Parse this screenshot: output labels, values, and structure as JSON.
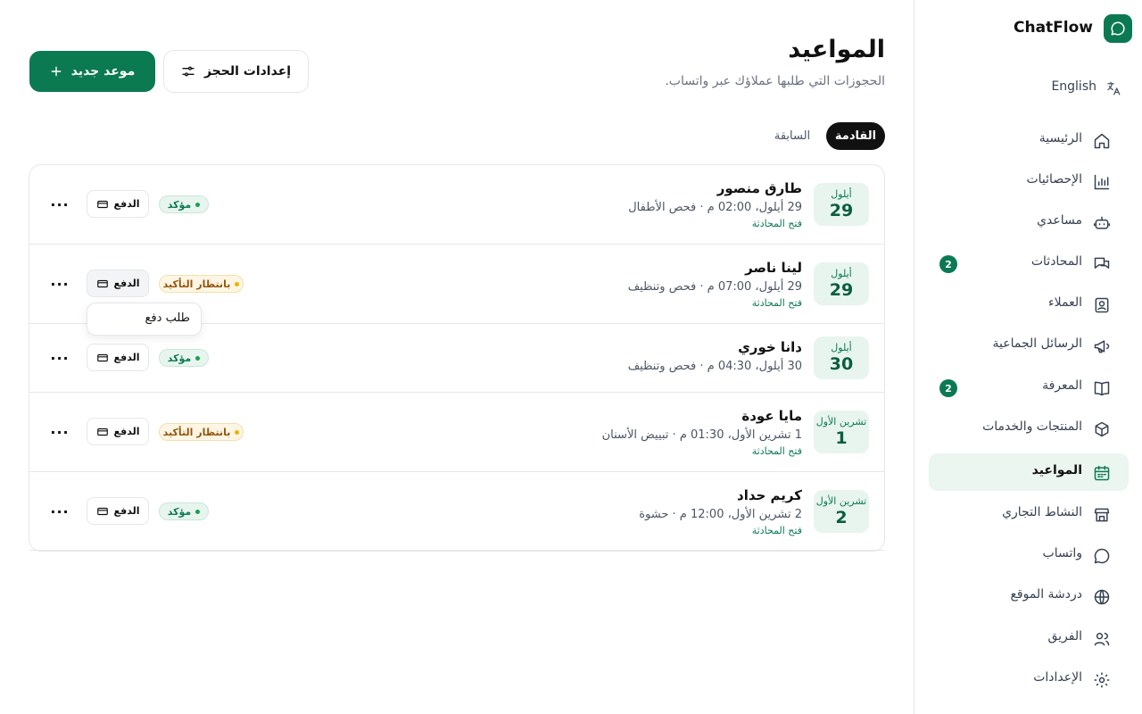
{
  "brand": {
    "name": "ChatFlow"
  },
  "language_toggle": "English",
  "nav": [
    {
      "key": "home",
      "label": "الرئيسية",
      "badge": null
    },
    {
      "key": "stats",
      "label": "الإحصائيات",
      "badge": null
    },
    {
      "key": "assistant",
      "label": "مساعدي",
      "badge": null
    },
    {
      "key": "conversations",
      "label": "المحادثات",
      "badge": "2"
    },
    {
      "key": "customers",
      "label": "العملاء",
      "badge": null
    },
    {
      "key": "broadcasts",
      "label": "الرسائل الجماعية",
      "badge": null
    },
    {
      "key": "knowledge",
      "label": "المعرفة",
      "badge": "2"
    },
    {
      "key": "products",
      "label": "المنتجات والخدمات",
      "badge": null
    },
    {
      "key": "appointments",
      "label": "المواعيد",
      "badge": null,
      "active": true
    },
    {
      "key": "business",
      "label": "النشاط التجاري",
      "badge": null
    },
    {
      "key": "whatsapp",
      "label": "واتساب",
      "badge": null
    },
    {
      "key": "webchat",
      "label": "دردشة الموقع",
      "badge": null
    },
    {
      "key": "team",
      "label": "الفريق",
      "badge": null
    },
    {
      "key": "settings",
      "label": "الإعدادات",
      "badge": null
    }
  ],
  "header": {
    "title": "المواعيد",
    "subtitle": "الحجوزات التي طلبها عملاؤك عبر واتساب.",
    "new_appointment": "موعد جديد",
    "booking_settings": "إعدادات الحجز"
  },
  "tabs": {
    "upcoming": "القادمة",
    "past": "السابقة"
  },
  "appointments": [
    {
      "month": "أيلول",
      "day": "29",
      "name": "طارق منصور",
      "detail": "29 أيلول، 02:00 م · فحص الأطفال",
      "open_chat": "فتح المحادثة",
      "status": "مؤكد",
      "status_type": "confirmed",
      "pay": "الدفع"
    },
    {
      "month": "أيلول",
      "day": "29",
      "name": "لينا ناصر",
      "detail": "29 أيلول، 07:00 م · فحص وتنظيف",
      "open_chat": "فتح المحادثة",
      "status": "بانتظار التأكيد",
      "status_type": "pending",
      "pay": "الدفع"
    },
    {
      "month": "أيلول",
      "day": "30",
      "name": "دانا خوري",
      "detail": "30 أيلول، 04:30 م · فحص وتنظيف",
      "open_chat": "فتح المحادثة",
      "status": "مؤكد",
      "status_type": "confirmed",
      "pay": "الدفع"
    },
    {
      "month": "تشرين الأول",
      "day": "1",
      "name": "مايا عودة",
      "detail": "1 تشرين الأول، 01:30 م · تبييض الأسنان",
      "open_chat": "فتح المحادثة",
      "status": "بانتظار التأكيد",
      "status_type": "pending",
      "pay": "الدفع"
    },
    {
      "month": "تشرين الأول",
      "day": "2",
      "name": "كريم حداد",
      "detail": "2 تشرين الأول، 12:00 م · حشوة",
      "open_chat": "فتح المحادثة",
      "status": "مؤكد",
      "status_type": "confirmed",
      "pay": "الدفع"
    }
  ],
  "payment_dropdown": {
    "item": "طلب دفع"
  },
  "colors": {
    "accent": "#0b7a52",
    "accent_light": "#e8f5ee",
    "pending": "#92560e"
  }
}
